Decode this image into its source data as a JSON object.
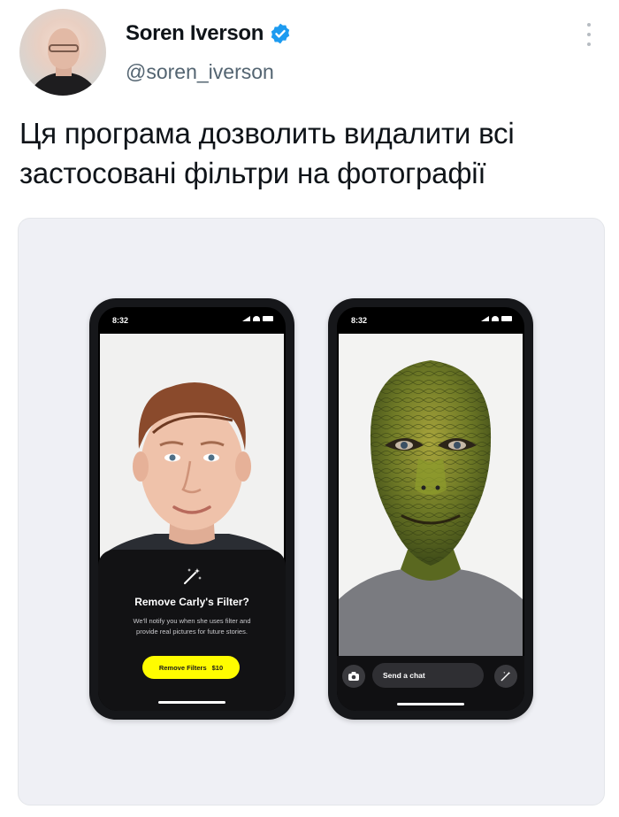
{
  "tweet": {
    "author_name": "Soren Iverson",
    "handle": "@soren_iverson",
    "text_line1": "Ця програма дозволить видалити всі",
    "text_line2": "застосовані фільтри на фотографії"
  },
  "phones": {
    "left": {
      "time": "8:32",
      "sheet_title": "Remove Carly's Filter?",
      "sheet_desc_line1": "We'll notify you when she uses filter and",
      "sheet_desc_line2": "provide real pictures for future stories.",
      "button_label": "Remove Filters",
      "button_price": "$10"
    },
    "right": {
      "time": "8:32",
      "chat_placeholder": "Send a chat"
    }
  },
  "colors": {
    "verified": "#1d9bf0",
    "cta": "#fffc00"
  },
  "icons": [
    "verified-badge-icon",
    "more-options-icon",
    "magic-wand-icon",
    "camera-icon"
  ]
}
